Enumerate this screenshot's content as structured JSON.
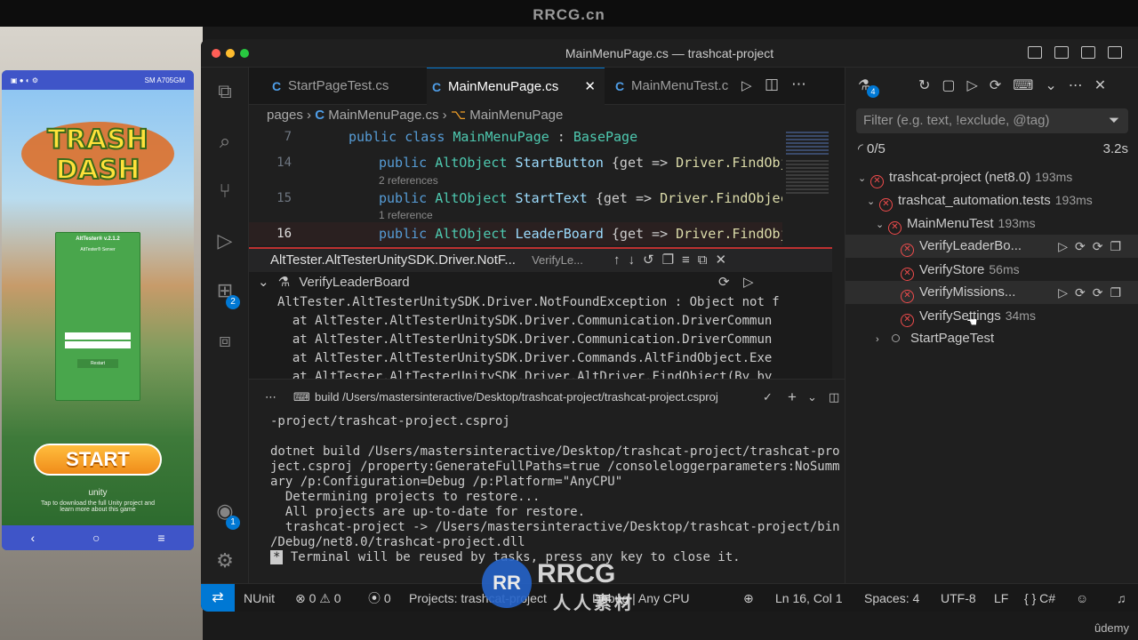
{
  "watermark": {
    "top": "RRCG.cn",
    "brand": "RRCG",
    "sub": "人人素材",
    "corner": "ûdemy"
  },
  "phone": {
    "status_device": "SM A705GM",
    "logo_line1": "TRASH",
    "logo_line2": "DASH",
    "alt_title": "AltTester® v.2.1.2",
    "alt_server": "AltTester® Server",
    "alt_restart": "Restart",
    "start_label": "START",
    "unity_brand": "unity",
    "unity_text": "Tap to download the full Unity project and learn more about this game"
  },
  "window": {
    "title": "MainMenuPage.cs — trashcat-project"
  },
  "activity": {
    "testing_badge": "4",
    "extensions_badge": "2",
    "account_badge": "1"
  },
  "tabs": [
    {
      "label": "StartPageTest.cs"
    },
    {
      "label": "MainMenuPage.cs",
      "active": true
    },
    {
      "label": "MainMenuTest.c"
    }
  ],
  "breadcrumb": {
    "folder": "pages",
    "file": "MainMenuPage.cs",
    "symbol": "MainMenuPage"
  },
  "code": [
    {
      "line": "7",
      "kw": "public class ",
      "type": "MainMenuPage",
      "rest": " : ",
      "type2": "BasePage"
    },
    {
      "line": "14",
      "kw": "public ",
      "type": "AltObject",
      "name": " StartButton ",
      "rest": "{get => ",
      "call": "Driver.FindObject",
      "ref": "2 references"
    },
    {
      "line": "15",
      "kw": "public ",
      "type": "AltObject",
      "name": " StartText ",
      "rest": "{get => ",
      "call": "Driver.FindObject(",
      "ref": "1 reference"
    },
    {
      "line": "16",
      "kw": "public ",
      "type": "AltObject",
      "name": " LeaderBoard ",
      "rest": "{get => ",
      "call": "Driver.FindObject"
    }
  ],
  "peek": {
    "title": "AltTester.AltTesterUnitySDK.Driver.NotF...",
    "subtitle": "VerifyLe...",
    "test_name": "VerifyLeaderBoard",
    "lines": [
      "AltTester.AltTesterUnitySDK.Driver.NotFoundException : Object not f",
      "  at AltTester.AltTesterUnitySDK.Driver.Communication.DriverCommun",
      "  at AltTester.AltTesterUnitySDK.Driver.Communication.DriverCommun",
      "  at AltTester.AltTesterUnitySDK.Driver.Commands.AltFindObject.Exe",
      "  at AltTester.AltTesterUnitySDK.Driver.AltDriver.FindObject(By by"
    ]
  },
  "terminal": {
    "title": "build /Users/mastersinteractive/Desktop/trashcat-project/trashcat-project.csproj",
    "lines": [
      "-project/trashcat-project.csproj",
      "",
      "dotnet build /Users/mastersinteractive/Desktop/trashcat-project/trashcat-pro",
      "ject.csproj /property:GenerateFullPaths=true /consoleloggerparameters:NoSumm",
      "ary /p:Configuration=Debug /p:Platform=\"AnyCPU\"",
      "  Determining projects to restore...",
      "  All projects are up-to-date for restore.",
      "  trashcat-project -> /Users/mastersinteractive/Desktop/trashcat-project/bin",
      "/Debug/net8.0/trashcat-project.dll"
    ],
    "reuse": "Terminal will be reused by tasks, press any key to close it."
  },
  "tests": {
    "filter_placeholder": "Filter (e.g. text, !exclude, @tag)",
    "progress": "0/5",
    "elapsed": "3.2s",
    "rows": [
      {
        "label": "trashcat-project (net8.0)",
        "dur": "193ms",
        "indent": 0,
        "status": "fail",
        "chev": "v"
      },
      {
        "label": "trashcat_automation.tests",
        "dur": "193ms",
        "indent": 1,
        "status": "fail",
        "chev": "v"
      },
      {
        "label": "MainMenuTest",
        "dur": "193ms",
        "indent": 2,
        "status": "fail",
        "chev": "v"
      },
      {
        "label": "VerifyLeaderBo...",
        "dur": "",
        "indent": 3,
        "status": "fail",
        "selected": true,
        "actions": true
      },
      {
        "label": "VerifyStore",
        "dur": "56ms",
        "indent": 3,
        "status": "fail"
      },
      {
        "label": "VerifyMissions...",
        "dur": "",
        "indent": 3,
        "status": "fail",
        "selected": true,
        "actions": true
      },
      {
        "label": "VerifySettings",
        "dur": "34ms",
        "indent": 3,
        "status": "fail"
      },
      {
        "label": "StartPageTest",
        "dur": "",
        "indent": 2,
        "status": "none",
        "chev": ">"
      }
    ]
  },
  "status": {
    "nunit": "NUnit",
    "errors": "0",
    "warnings": "0",
    "ports": "0",
    "projects": "Projects: trashcat-project",
    "config": "Debug | Any CPU",
    "position": "Ln 16, Col 1",
    "spaces": "Spaces: 4",
    "encoding": "UTF-8",
    "eol": "LF",
    "lang": "C#"
  }
}
